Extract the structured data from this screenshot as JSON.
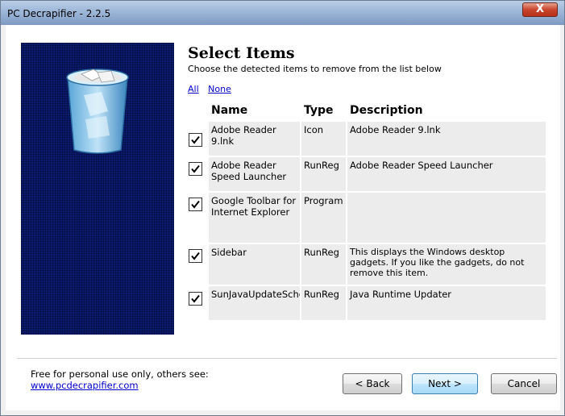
{
  "window": {
    "title": "PC Decrapifier - 2.2.5",
    "close_label": "X"
  },
  "header": {
    "title": "Select Items",
    "subtitle": "Choose the detected items to remove from the list below"
  },
  "selection_links": {
    "all": "All",
    "none": "None"
  },
  "table": {
    "columns": {
      "name": "Name",
      "type": "Type",
      "description": "Description"
    },
    "rows": [
      {
        "checked": true,
        "name": "Adobe Reader 9.lnk",
        "type": "Icon",
        "description": "Adobe Reader 9.lnk"
      },
      {
        "checked": true,
        "name": "Adobe Reader Speed Launcher",
        "type": "RunReg",
        "description": "Adobe Reader Speed Launcher"
      },
      {
        "checked": true,
        "name": "Google Toolbar for Internet Explorer",
        "type": "Program",
        "description": ""
      },
      {
        "checked": true,
        "name": "Sidebar",
        "type": "RunReg",
        "description": "This displays the Windows desktop gadgets. If you like the gadgets, do not remove this item."
      },
      {
        "checked": true,
        "name": "SunJavaUpdateSched",
        "type": "RunReg",
        "description": "Java Runtime Updater"
      }
    ]
  },
  "footer": {
    "license_text": "Free for personal use only, others see:",
    "url": "www.pcdecrapifier.com",
    "back_label": "< Back",
    "next_label": "Next >",
    "cancel_label": "Cancel"
  },
  "colors": {
    "sidebar_bg": "#0a1a6e",
    "link": "#0000cc",
    "close_button": "#c9452c"
  },
  "icons": [
    "recycle-bin-icon",
    "checkmark-icon",
    "close-icon"
  ]
}
